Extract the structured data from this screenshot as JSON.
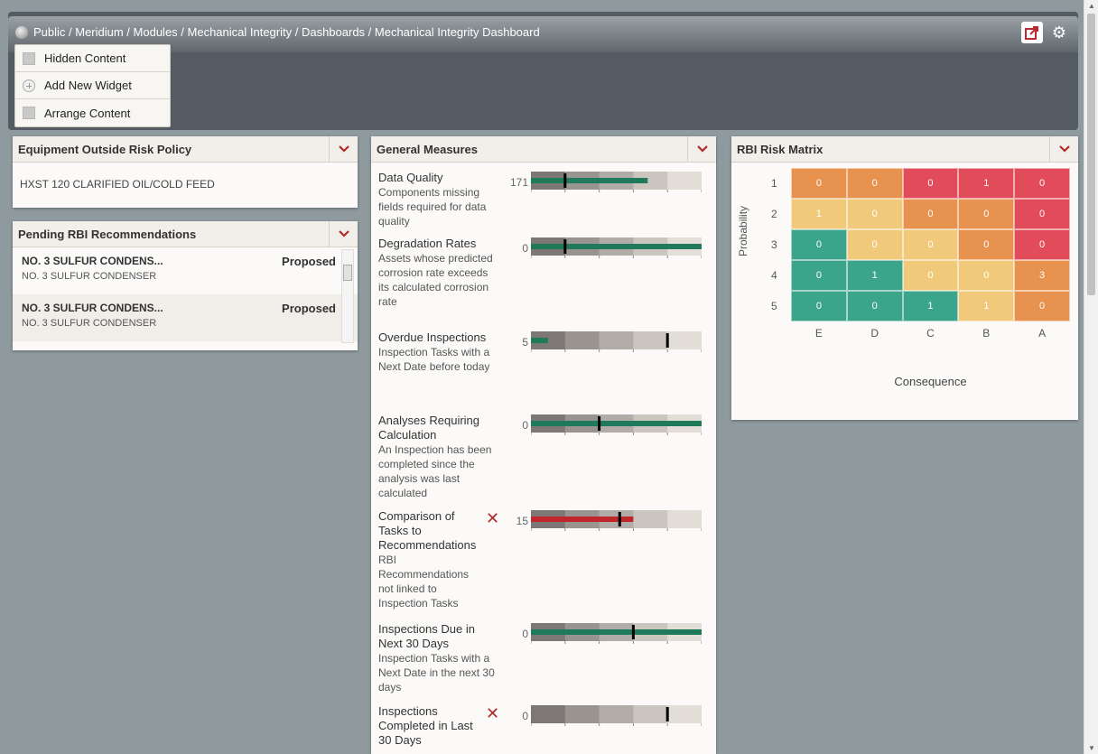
{
  "header": {
    "breadcrumb": "Public / Meridium / Modules / Mechanical Integrity / Dashboards / Mechanical Integrity Dashboard"
  },
  "menu": {
    "items": [
      {
        "label": "Hidden Content",
        "icon": "hidden-content-icon"
      },
      {
        "label": "Add New Widget",
        "icon": "add-circle-icon"
      },
      {
        "label": "Arrange Content",
        "icon": "arrange-content-icon"
      }
    ]
  },
  "equipment_panel": {
    "title": "Equipment Outside Risk Policy",
    "row": "HXST 120 CLARIFIED OIL/COLD FEED"
  },
  "pending_panel": {
    "title": "Pending RBI Recommendations",
    "items": [
      {
        "title": "NO. 3 SULFUR CONDENS...",
        "sub": "NO. 3 SULFUR CONDENSER",
        "status": "Proposed"
      },
      {
        "title": "NO. 3 SULFUR CONDENS...",
        "sub": "NO. 3 SULFUR CONDENSER",
        "status": "Proposed"
      }
    ]
  },
  "measures_panel": {
    "title": "General Measures",
    "measures": [
      {
        "label": "Data Quality",
        "desc": "Components missing fields required for data quality",
        "value": "171",
        "bar": 171,
        "target": 200,
        "ticks": [
          "250",
          "200",
          "150",
          "100",
          "50",
          "0"
        ],
        "max": 250,
        "reversed": true,
        "color": "#1f7a5c",
        "alert": false
      },
      {
        "label": "Degradation Rates",
        "desc": "Assets whose predicted corrosion rate exceeds its calculated corrosion rate",
        "value": "0",
        "bar": 0,
        "target": 8,
        "ticks": [
          "10",
          "8",
          "6",
          "4",
          "2",
          "0"
        ],
        "max": 10,
        "reversed": true,
        "color": "#1f7a5c",
        "alert": false
      },
      {
        "label": "Overdue Inspections",
        "desc": "Inspection Tasks with a Next Date before today",
        "value": "5",
        "bar": 5,
        "target": 10,
        "ticks": [
          "50",
          "40",
          "30",
          "20",
          "10",
          "0"
        ],
        "max": 50,
        "reversed": true,
        "color": "#1f7a5c",
        "alert": false
      },
      {
        "label": "Analyses Requiring Calculation",
        "desc": "An Inspection has been completed since the analysis was last calculated",
        "value": "0",
        "bar": 0,
        "target": 15,
        "ticks": [
          "25",
          "20",
          "15",
          "10",
          "5",
          "0"
        ],
        "max": 25,
        "reversed": true,
        "color": "#1f7a5c",
        "alert": false
      },
      {
        "label": "Comparison of Tasks to Recommendations",
        "desc": "RBI Recommendations not linked to Inspection Tasks",
        "value": "15",
        "bar": 15,
        "target": 12,
        "ticks": [
          "25",
          "20",
          "15",
          "10",
          "5",
          "0"
        ],
        "max": 25,
        "reversed": true,
        "color": "#c0272d",
        "alert": true
      },
      {
        "label": "Inspections Due in Next 30 Days",
        "desc": "Inspection Tasks with a Next Date in the next 30 days",
        "value": "0",
        "bar": 0,
        "target": 10,
        "ticks": [
          "25",
          "20",
          "15",
          "10",
          "5",
          "0"
        ],
        "max": 25,
        "reversed": true,
        "color": "#1f7a5c",
        "alert": false
      },
      {
        "label": "Inspections Completed in Last 30 Days",
        "desc": "",
        "value": "0",
        "bar": 0,
        "target": 20,
        "ticks": [
          "0",
          "5",
          "10",
          "15",
          "20",
          "25"
        ],
        "max": 25,
        "reversed": false,
        "color": "#1f7a5c",
        "alert": true
      }
    ]
  },
  "matrix_panel": {
    "title": "RBI Risk Matrix",
    "y_axis_label": "Probability",
    "x_axis_label": "Consequence",
    "rows": [
      "1",
      "2",
      "3",
      "4",
      "5"
    ],
    "cols": [
      "E",
      "D",
      "C",
      "B",
      "A"
    ],
    "colors": {
      "green": "#3aa58a",
      "yellow": "#f0c97a",
      "orange": "#e8924f",
      "red": "#e24b5a"
    }
  },
  "chart_data": {
    "type": "heatmap",
    "title": "RBI Risk Matrix",
    "xlabel": "Consequence",
    "ylabel": "Probability",
    "x": [
      "E",
      "D",
      "C",
      "B",
      "A"
    ],
    "y": [
      "1",
      "2",
      "3",
      "4",
      "5"
    ],
    "values": [
      [
        0,
        0,
        0,
        1,
        0
      ],
      [
        1,
        0,
        0,
        0,
        0
      ],
      [
        0,
        0,
        0,
        0,
        0
      ],
      [
        0,
        1,
        0,
        0,
        3
      ],
      [
        0,
        0,
        1,
        1,
        0
      ]
    ],
    "risk_levels": [
      [
        "orange",
        "orange",
        "red",
        "red",
        "red"
      ],
      [
        "yellow",
        "yellow",
        "orange",
        "orange",
        "red"
      ],
      [
        "green",
        "yellow",
        "yellow",
        "orange",
        "red"
      ],
      [
        "green",
        "green",
        "yellow",
        "yellow",
        "orange"
      ],
      [
        "green",
        "green",
        "green",
        "yellow",
        "orange"
      ]
    ]
  }
}
